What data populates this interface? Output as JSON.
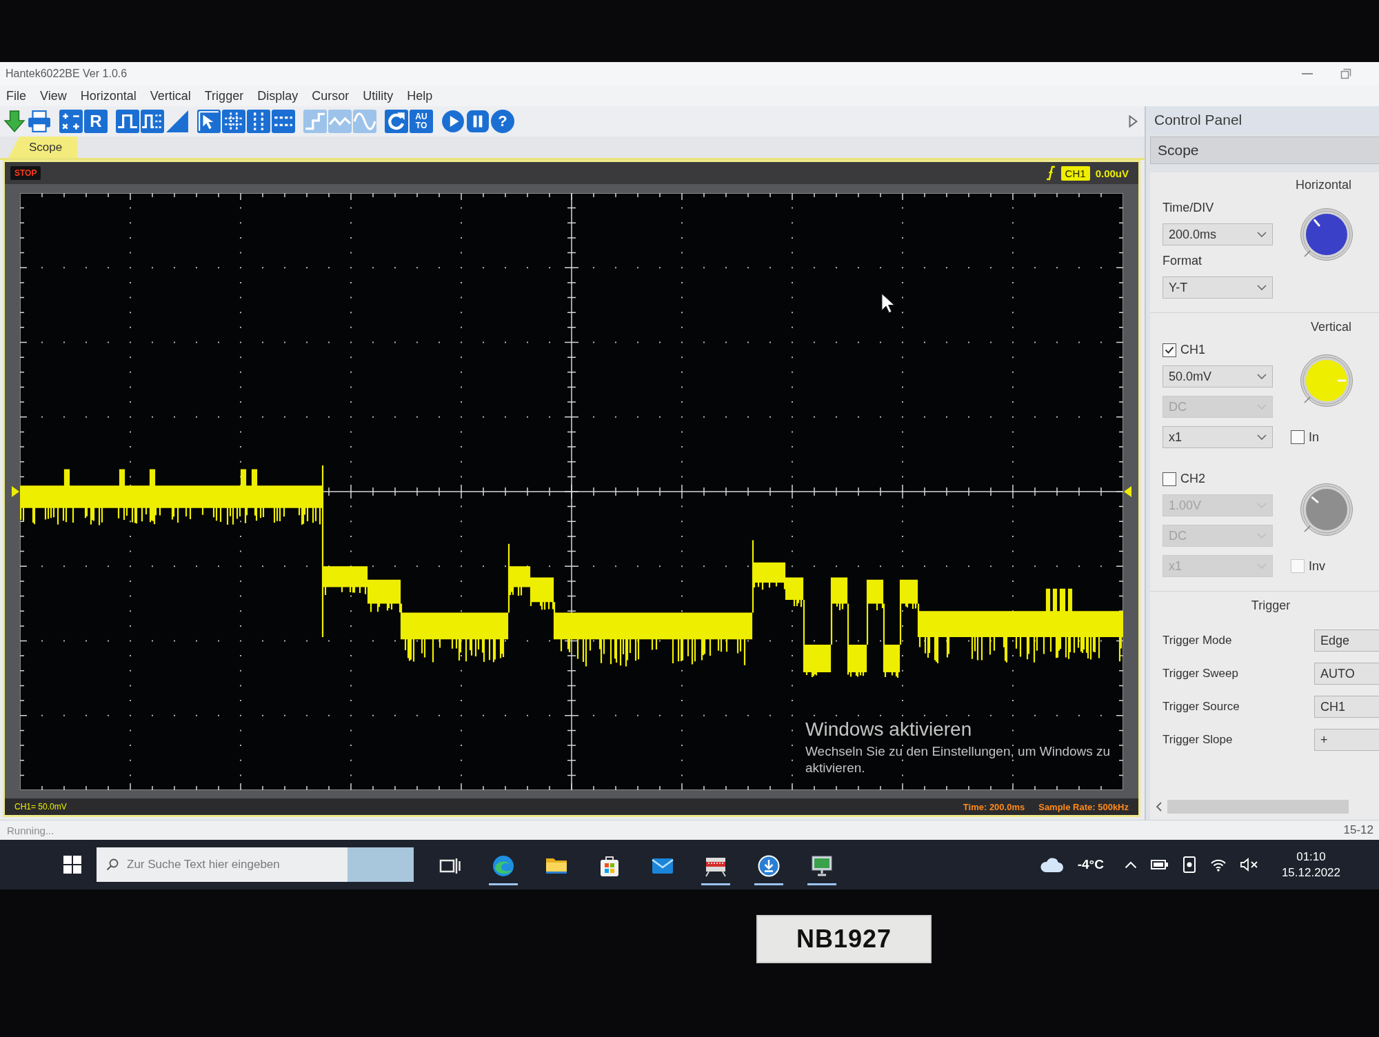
{
  "window": {
    "title": "Hantek6022BE Ver 1.0.6"
  },
  "menu": [
    "File",
    "View",
    "Horizontal",
    "Vertical",
    "Trigger",
    "Display",
    "Cursor",
    "Utility",
    "Help"
  ],
  "toolbar": [
    {
      "disabled": false
    },
    {
      "disabled": false
    },
    {
      "disabled": false
    },
    {
      "label": "R",
      "disabled": false
    },
    {
      "disabled": false
    },
    {
      "disabled": false
    },
    {
      "disabled": false
    },
    {
      "disabled": false
    },
    {
      "disabled": false
    },
    {
      "disabled": false
    },
    {
      "disabled": false
    },
    {
      "disabled": true
    },
    {
      "disabled": true
    },
    {
      "disabled": true
    },
    {
      "disabled": false
    },
    {
      "label": "AUTO",
      "disabled": false
    },
    {
      "disabled": false
    },
    {
      "disabled": false
    },
    {
      "label": "?",
      "disabled": false
    }
  ],
  "tabs": [
    {
      "label": "Scope",
      "selected": true
    }
  ],
  "scope": {
    "run_state": "STOP",
    "trigger_channel": "CH1",
    "trigger_level": "0.00uV",
    "channel_scale": "CH1= 50.0mV",
    "time_base": "Time: 200.0ms",
    "sample_rate": "Sample Rate: 500kHz"
  },
  "control_panel": {
    "title": "Control Panel",
    "section": "Scope",
    "horizontal": {
      "title": "Horizontal",
      "fields": [
        {
          "label": "Time/DIV",
          "value": "200.0ms"
        },
        {
          "label": "Format",
          "value": "Y-T"
        }
      ]
    },
    "vertical": {
      "title": "Vertical",
      "channels": [
        {
          "name": "CH1",
          "checked": true,
          "color": "#eeee00",
          "settings": [
            {
              "value": "50.0mV",
              "disabled": false
            },
            {
              "value": "DC",
              "disabled": true
            },
            {
              "value": "x1",
              "disabled": false
            }
          ],
          "invert": {
            "label": "In",
            "checked": false,
            "disabled": false
          }
        },
        {
          "name": "CH2",
          "checked": false,
          "color": "#8e8e8e",
          "settings": [
            {
              "value": "1.00V",
              "disabled": true
            },
            {
              "value": "DC",
              "disabled": true
            },
            {
              "value": "x1",
              "disabled": true
            }
          ],
          "invert": {
            "label": "Inv",
            "checked": false,
            "disabled": true
          }
        }
      ]
    },
    "trigger": {
      "title": "Trigger",
      "rows": [
        {
          "label": "Trigger Mode",
          "value": "Edge"
        },
        {
          "label": "Trigger Sweep",
          "value": "AUTO"
        },
        {
          "label": "Trigger Source",
          "value": "CH1"
        },
        {
          "label": "Trigger Slope",
          "value": "+"
        }
      ]
    }
  },
  "status_bar": {
    "status": "Running...",
    "clock": "15-12"
  },
  "activation_notice": {
    "title": "Windows aktivieren",
    "message": "Wechseln Sie zu den Einstellungen, um Windows zu aktivieren."
  },
  "taskbar": {
    "search": {
      "placeholder": "Zur Suche Text hier eingeben"
    },
    "apps": [
      {
        "running": false
      },
      {
        "running": true
      },
      {
        "running": false
      },
      {
        "running": false
      },
      {
        "running": false
      },
      {
        "running": true
      },
      {
        "running": true
      },
      {
        "running": true
      }
    ],
    "weather": "-4°C",
    "time": "01:10",
    "date": "15.12.2022"
  },
  "asset_tag": "NB1927"
}
